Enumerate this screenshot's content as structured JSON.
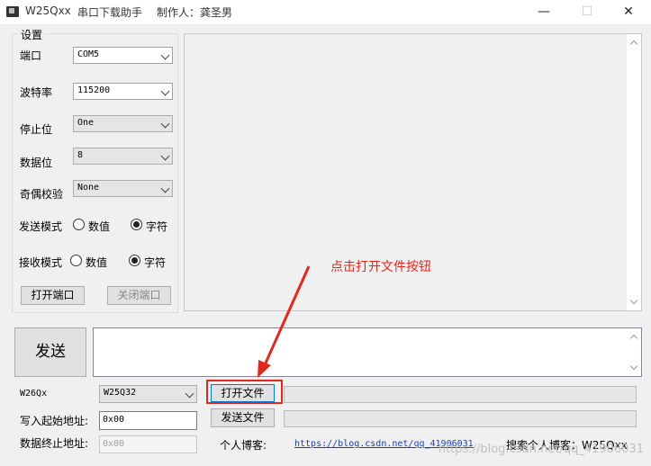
{
  "titlebar": {
    "app": "W25Qxx",
    "tool": "串口下载助手",
    "author": "制作人：龚圣男"
  },
  "settings": {
    "group_title": "设置",
    "port_label": "端口",
    "port_value": "COM5",
    "baud_label": "波特率",
    "baud_value": "115200",
    "stop_label": "停止位",
    "stop_value": "One",
    "data_label": "数据位",
    "data_value": "8",
    "parity_label": "奇偶校验",
    "parity_value": "None",
    "send_mode_label": "发送模式",
    "recv_mode_label": "接收模式",
    "numeric_label": "数值",
    "char_label": "字符",
    "open_port": "打开端口",
    "close_port": "关闭端口"
  },
  "send_button": "发送",
  "chip": {
    "label": "W26Qx",
    "value": "W25Q32"
  },
  "file": {
    "open": "打开文件",
    "send": "发送文件"
  },
  "address": {
    "start_label": "写入起始地址:",
    "start_value": "0x00",
    "end_label": "数据终止地址:",
    "end_value": "0x00"
  },
  "blog": {
    "label": "个人博客:",
    "url": "https://blog.csdn.net/qq_41906031",
    "search": "搜索个人博客：W25Qxx"
  },
  "annotation": "点击打开文件按钮",
  "watermark": "https://blog.csdn.net/qq_41906031",
  "colors": {
    "annotation": "#e0281e",
    "link": "#1a3fb8"
  }
}
